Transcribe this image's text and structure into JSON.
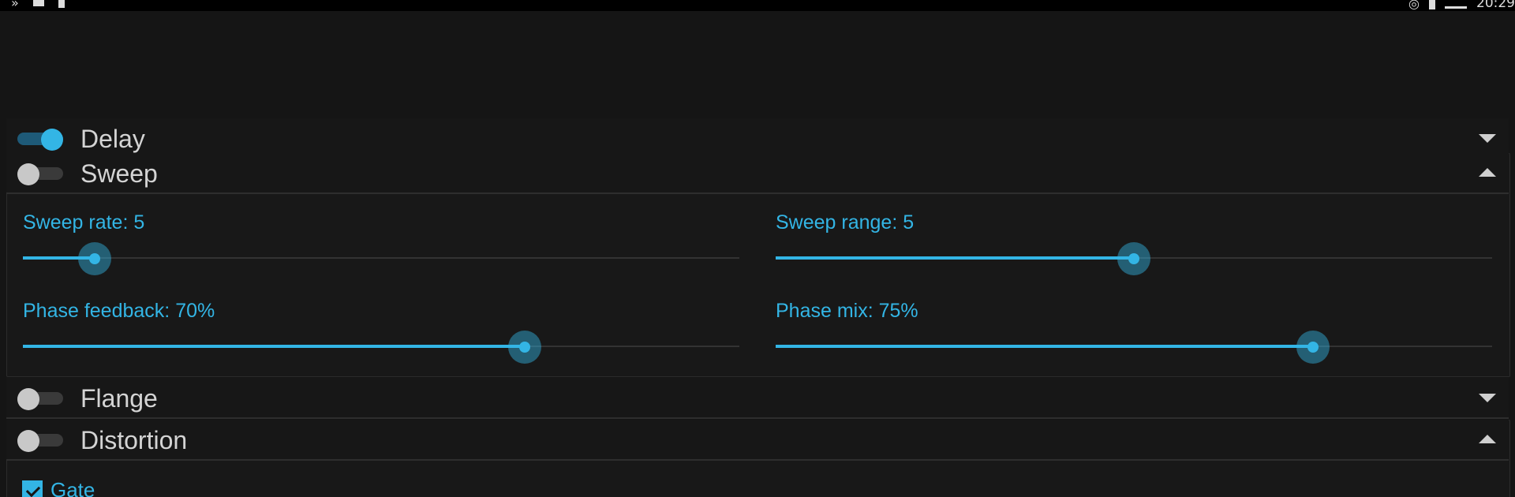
{
  "status_bar": {
    "left_icons": [
      "overflow-icon",
      "sd-card-icon",
      "download-icon"
    ],
    "right_icons": [
      "alarm-icon",
      "battery-icon",
      "signal-icon"
    ],
    "clock": "20:29"
  },
  "colors": {
    "accent": "#33b5e5",
    "background": "#151515",
    "header_text": "#d4d4d4"
  },
  "sections": [
    {
      "id": "delay",
      "title": "Delay",
      "enabled": true,
      "expanded": false
    },
    {
      "id": "sweep",
      "title": "Sweep",
      "enabled": false,
      "expanded": true
    },
    {
      "id": "flange",
      "title": "Flange",
      "enabled": false,
      "expanded": false
    },
    {
      "id": "distortion",
      "title": "Distortion",
      "enabled": false,
      "expanded": true
    }
  ],
  "sweep": {
    "sliders": [
      {
        "label": "Sweep rate: 5",
        "value_fraction": 0.1
      },
      {
        "label": "Sweep range: 5",
        "value_fraction": 0.5
      },
      {
        "label": "Phase feedback: 70%",
        "value_fraction": 0.7
      },
      {
        "label": "Phase mix: 75%",
        "value_fraction": 0.75
      }
    ]
  },
  "distortion": {
    "gate_label": "Gate",
    "gate_checked": true
  }
}
